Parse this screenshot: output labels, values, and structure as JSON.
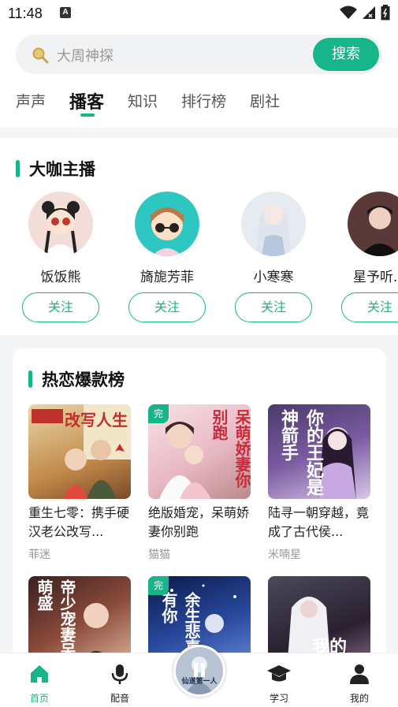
{
  "status_bar": {
    "time": "11:48",
    "badge": "A"
  },
  "search": {
    "placeholder": "大周神探",
    "button": "搜索"
  },
  "tabs": [
    {
      "label": "声声",
      "active": false
    },
    {
      "label": "播客",
      "active": true
    },
    {
      "label": "知识",
      "active": false
    },
    {
      "label": "排行榜",
      "active": false
    },
    {
      "label": "剧社",
      "active": false
    }
  ],
  "anchors_section": {
    "title": "大咖主播",
    "follow_label": "关注",
    "items": [
      {
        "name": "饭饭熊"
      },
      {
        "name": "旖旎芳菲"
      },
      {
        "name": "小寒寒"
      },
      {
        "name": "星予听..."
      }
    ]
  },
  "hot_section": {
    "title": "热恋爆款榜",
    "complete_tag": "完",
    "books": [
      {
        "title": "重生七零：携手硬汉老公改写...",
        "author": "菲迷",
        "complete": false,
        "cover_text": "改写人生"
      },
      {
        "title": "绝版婚宠，呆萌娇妻你别跑",
        "author": "猫猫",
        "complete": true,
        "cover_text": "呆萌娇妻你别跑"
      },
      {
        "title": "陆寻一朝穿越，竟成了古代侯...",
        "author": "米喃星",
        "complete": false,
        "cover_text": "你的王妃是神箭手"
      },
      {
        "title": "",
        "author": "",
        "complete": false,
        "cover_text": "帝少宠妻呆萌盛"
      },
      {
        "title": "",
        "author": "",
        "complete": true,
        "cover_text": "余生悲喜有你"
      },
      {
        "title": "",
        "author": "",
        "complete": false,
        "cover_text": "我的"
      }
    ]
  },
  "bottom_nav": [
    {
      "label": "首页",
      "icon": "home-icon",
      "active": true
    },
    {
      "label": "配音",
      "icon": "microphone-icon",
      "active": false
    },
    {
      "label": "学习",
      "icon": "graduation-cap-icon",
      "active": false
    },
    {
      "label": "我的",
      "icon": "user-icon",
      "active": false
    }
  ],
  "player": {
    "cover_text": "仙道第一人"
  },
  "colors": {
    "accent": "#16b58a",
    "text": "#222222",
    "muted": "#999999"
  }
}
